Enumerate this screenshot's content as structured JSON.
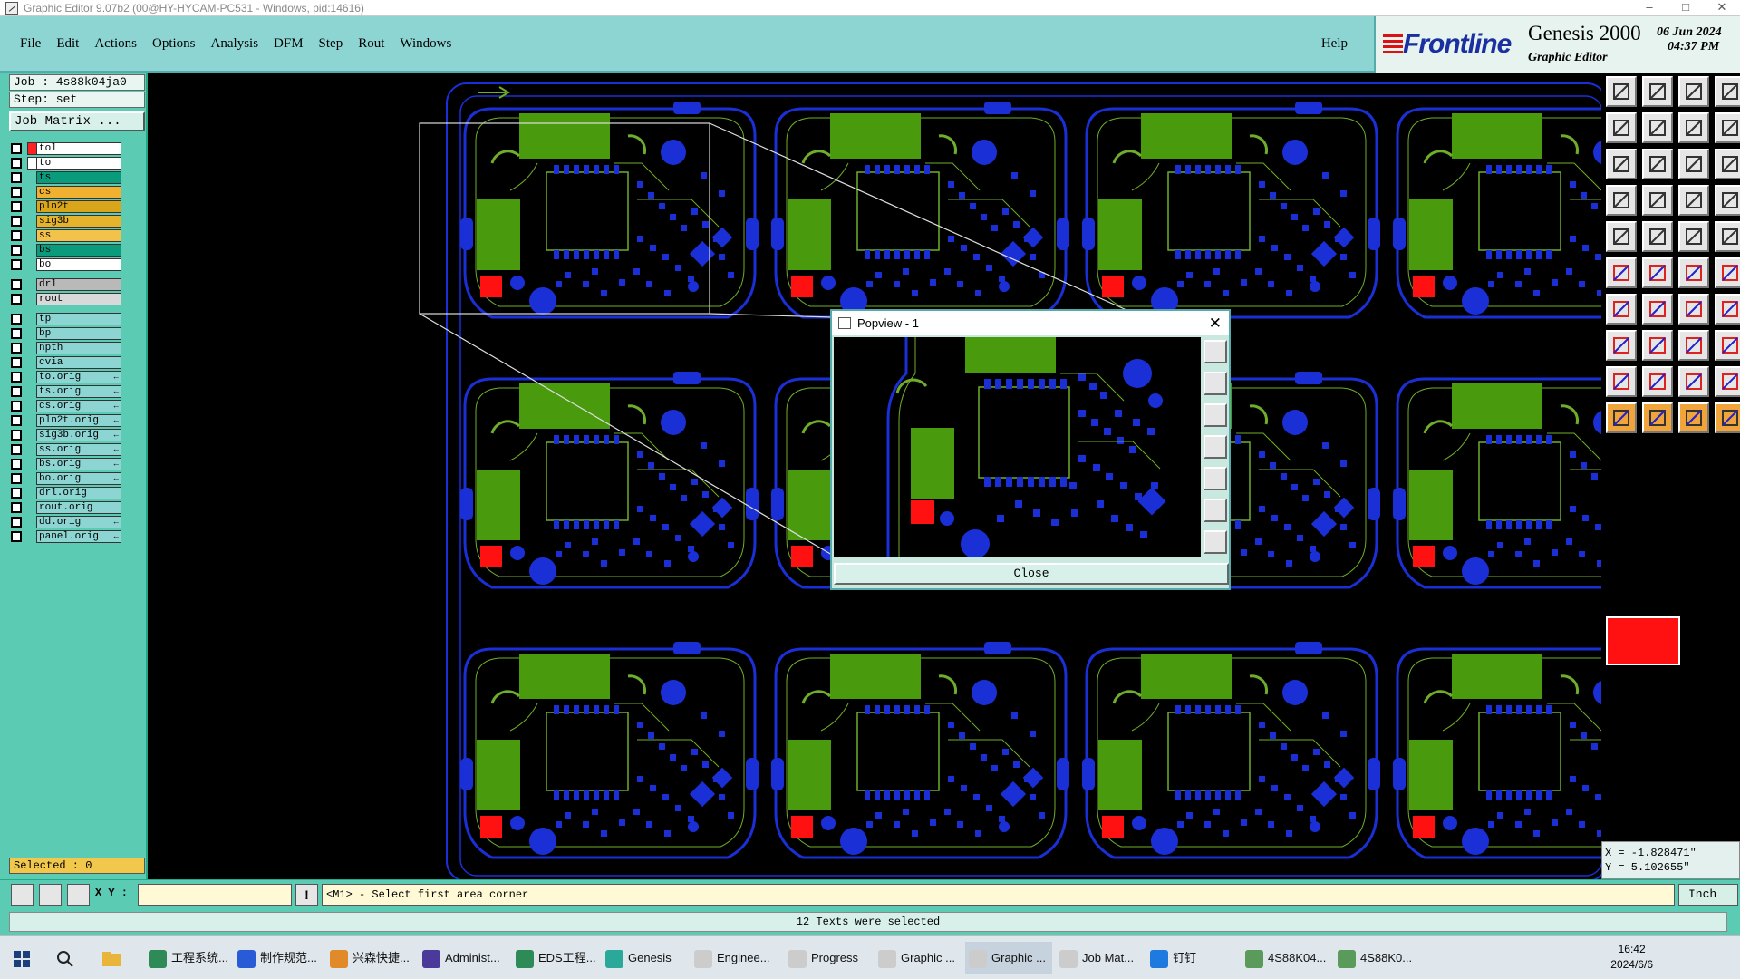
{
  "window": {
    "title": "Graphic Editor 9.07b2 (00@HY-HYCAM-PC531 - Windows, pid:14616)"
  },
  "menu": [
    "File",
    "Edit",
    "Actions",
    "Options",
    "Analysis",
    "DFM",
    "Step",
    "Rout",
    "Windows"
  ],
  "help": "Help",
  "brand": {
    "logo": "Frontline",
    "product": "Genesis 2000",
    "subtitle": "Graphic Editor",
    "date": "06 Jun 2024",
    "time": "04:37 PM"
  },
  "job": {
    "name": "Job : 4s88k04ja0",
    "step": "Step: set",
    "matrix_button": "Job Matrix ..."
  },
  "layers": [
    {
      "name": "tol",
      "color": "#ff2222",
      "bg": "#ffffff"
    },
    {
      "name": "to",
      "color": "#ffffff",
      "bg": "#ffffff"
    },
    {
      "name": "ts",
      "color": "#0a9b7c",
      "bg": "#0a9b7c"
    },
    {
      "name": "cs",
      "color": "#f0b030",
      "bg": "#f0b030"
    },
    {
      "name": "pln2t",
      "color": "#d9a51a",
      "bg": "#d9a51a"
    },
    {
      "name": "sig3b",
      "color": "#e6b42c",
      "bg": "#e6b42c"
    },
    {
      "name": "ss",
      "color": "#f3c24a",
      "bg": "#f3c24a"
    },
    {
      "name": "bs",
      "color": "#0a9b7c",
      "bg": "#0a9b7c"
    },
    {
      "name": "bo",
      "color": "#ffffff",
      "bg": "#ffffff"
    }
  ],
  "drill_layers": [
    {
      "name": "drl",
      "bg": "#b9b9b9"
    },
    {
      "name": "rout",
      "bg": "#d9d9d9"
    }
  ],
  "misc_layers": [
    {
      "name": "tp",
      "arrow": false
    },
    {
      "name": "bp",
      "arrow": false
    },
    {
      "name": "npth",
      "arrow": false
    },
    {
      "name": "cvia",
      "arrow": false
    },
    {
      "name": "to.orig",
      "arrow": true
    },
    {
      "name": "ts.orig",
      "arrow": true
    },
    {
      "name": "cs.orig",
      "arrow": true
    },
    {
      "name": "pln2t.orig",
      "arrow": true
    },
    {
      "name": "sig3b.orig",
      "arrow": true
    },
    {
      "name": "ss.orig",
      "arrow": true
    },
    {
      "name": "bs.orig",
      "arrow": true
    },
    {
      "name": "bo.orig",
      "arrow": true
    },
    {
      "name": "drl.orig",
      "arrow": false
    },
    {
      "name": "rout.orig",
      "arrow": false
    },
    {
      "name": "dd.orig",
      "arrow": true
    },
    {
      "name": "panel.orig",
      "arrow": true
    }
  ],
  "selected": "Selected : 0",
  "coords": {
    "x": "X = -1.828471\"",
    "y": "Y = 5.102655\""
  },
  "cmd": {
    "xy_label": "X Y :",
    "xy_value": "",
    "prompt": "<M1> - Select first area corner",
    "units": "Inch"
  },
  "status": "12 Texts were selected",
  "popview": {
    "title": "Popview - 1",
    "close": "Close"
  },
  "taskbar": [
    {
      "label": "工程系统...",
      "color": "#2e8b57"
    },
    {
      "label": "制作规范...",
      "color": "#2a5bd7"
    },
    {
      "label": "兴森快捷...",
      "color": "#e08a2a"
    },
    {
      "label": "Administ...",
      "color": "#4a3a9a"
    },
    {
      "label": "EDS工程...",
      "color": "#2e8b57"
    },
    {
      "label": "Genesis",
      "color": "#2aa89a"
    },
    {
      "label": "Enginee...",
      "color": "#cccccc"
    },
    {
      "label": "Progress",
      "color": "#cccccc"
    },
    {
      "label": "Graphic ...",
      "color": "#cccccc"
    },
    {
      "label": "Graphic ...",
      "color": "#cccccc"
    },
    {
      "label": "Job Mat...",
      "color": "#cccccc"
    },
    {
      "label": "钉钉",
      "color": "#1f7ae0"
    },
    {
      "label": "4S88K04...",
      "color": "#5a9a5a"
    },
    {
      "label": "4S88K0...",
      "color": "#5a9a5a"
    }
  ],
  "clock": {
    "time": "16:42",
    "date": "2024/6/6"
  }
}
